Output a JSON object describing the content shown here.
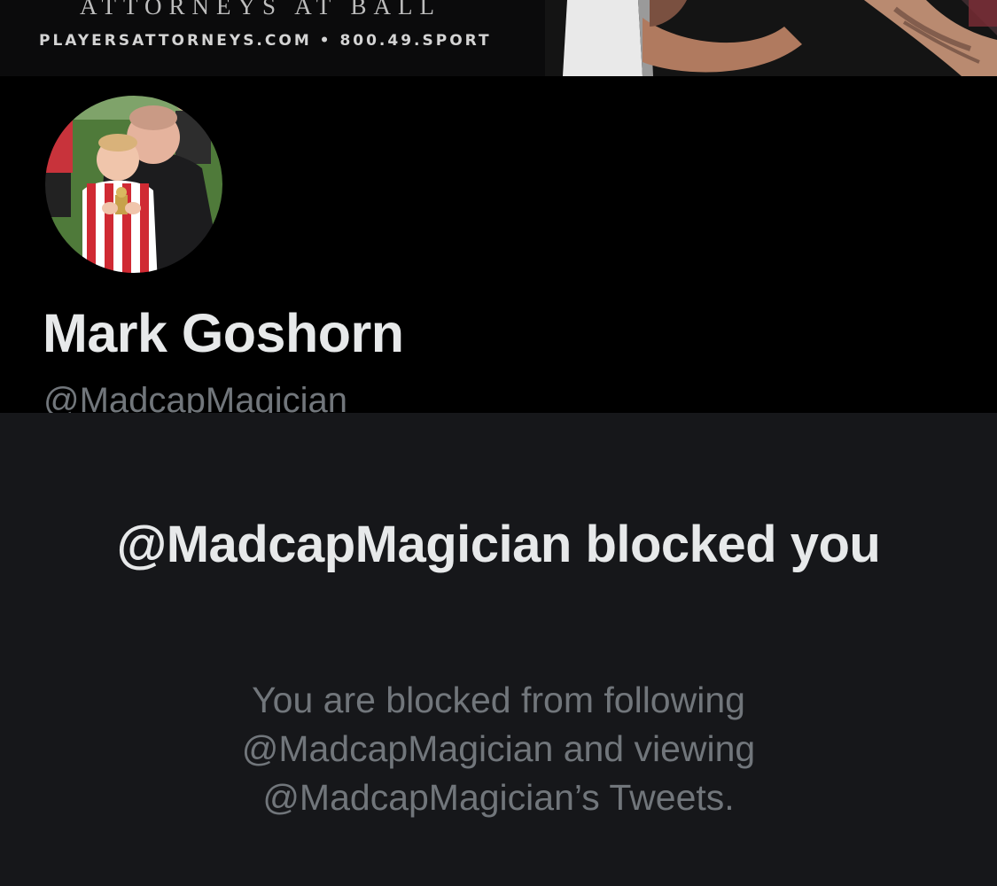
{
  "banner": {
    "tagline": "ATTORNEYS AT BALL",
    "contact": "PLAYERSATTORNEYS.COM • 800.49.SPORT"
  },
  "profile": {
    "display_name": "Mark Goshorn",
    "handle": "@MadcapMagician"
  },
  "blocked_notice": {
    "title": "@MadcapMagician blocked you",
    "body": "You are blocked from following @MadcapMagician and viewing @MadcapMagician’s Tweets."
  },
  "colors": {
    "profile_background": "#000000",
    "panel_background": "#16171a",
    "primary_text": "#e7e9ea",
    "secondary_text": "#71767b"
  }
}
